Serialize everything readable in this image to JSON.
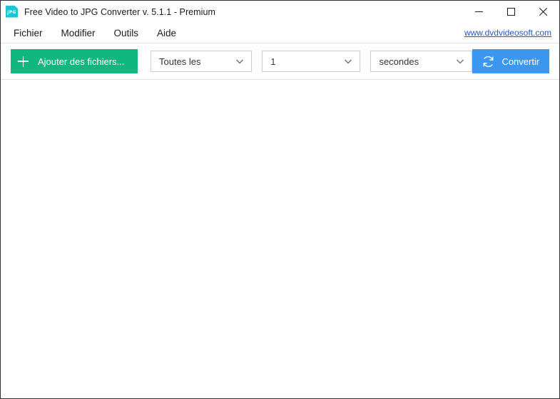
{
  "window": {
    "title": "Free Video to JPG Converter v. 5.1.1 - Premium",
    "app_icon_label": "JPG",
    "icon_color": "#18c6d4",
    "controls": {
      "minimize": "minimize-button",
      "maximize": "maximize-button",
      "close": "close-button"
    }
  },
  "menubar": {
    "items": [
      {
        "label": "Fichier"
      },
      {
        "label": "Modifier"
      },
      {
        "label": "Outils"
      },
      {
        "label": "Aide"
      }
    ],
    "link": {
      "label": "www.dvdvideosoft.com",
      "color": "#2a56c6"
    }
  },
  "toolbar": {
    "add_files": {
      "label": "Ajouter des fichiers...",
      "icon": "plus-icon",
      "color": "#10b77f"
    },
    "mode_select": {
      "value": "Toutes les",
      "icon": "chevron-down-icon"
    },
    "interval_select": {
      "value": "1",
      "icon": "chevron-down-icon"
    },
    "unit_select": {
      "value": "secondes",
      "icon": "chevron-down-icon"
    },
    "convert": {
      "label": "Convertir",
      "icon": "convert-arrows-icon",
      "color": "#3c97f0"
    }
  },
  "content": {
    "file_list_empty": ""
  }
}
